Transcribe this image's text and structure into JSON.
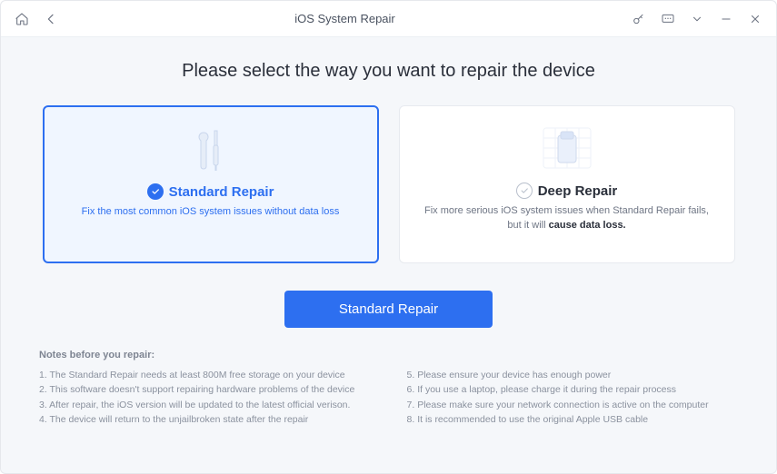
{
  "window": {
    "title": "iOS System Repair"
  },
  "headline": "Please select the way you want to repair the device",
  "cards": {
    "standard": {
      "title": "Standard Repair",
      "desc": "Fix the most common iOS system issues without data loss"
    },
    "deep": {
      "title": "Deep Repair",
      "desc_pre": "Fix more serious iOS system issues when Standard Repair fails, but it will ",
      "desc_warn": "cause data loss."
    }
  },
  "primary_button": "Standard Repair",
  "notes": {
    "title": "Notes before you repair:",
    "items": [
      "The Standard Repair needs at least 800M free storage on your device",
      "This software doesn't support repairing hardware problems of the device",
      "After repair, the iOS version will be updated to the latest official verison.",
      "The device will return to the unjailbroken state after the repair",
      "Please ensure your device has enough power",
      "If you use a laptop, please charge it during the repair process",
      "Please make sure your network connection is active on the computer",
      "It is recommended to use the original Apple USB cable"
    ]
  }
}
